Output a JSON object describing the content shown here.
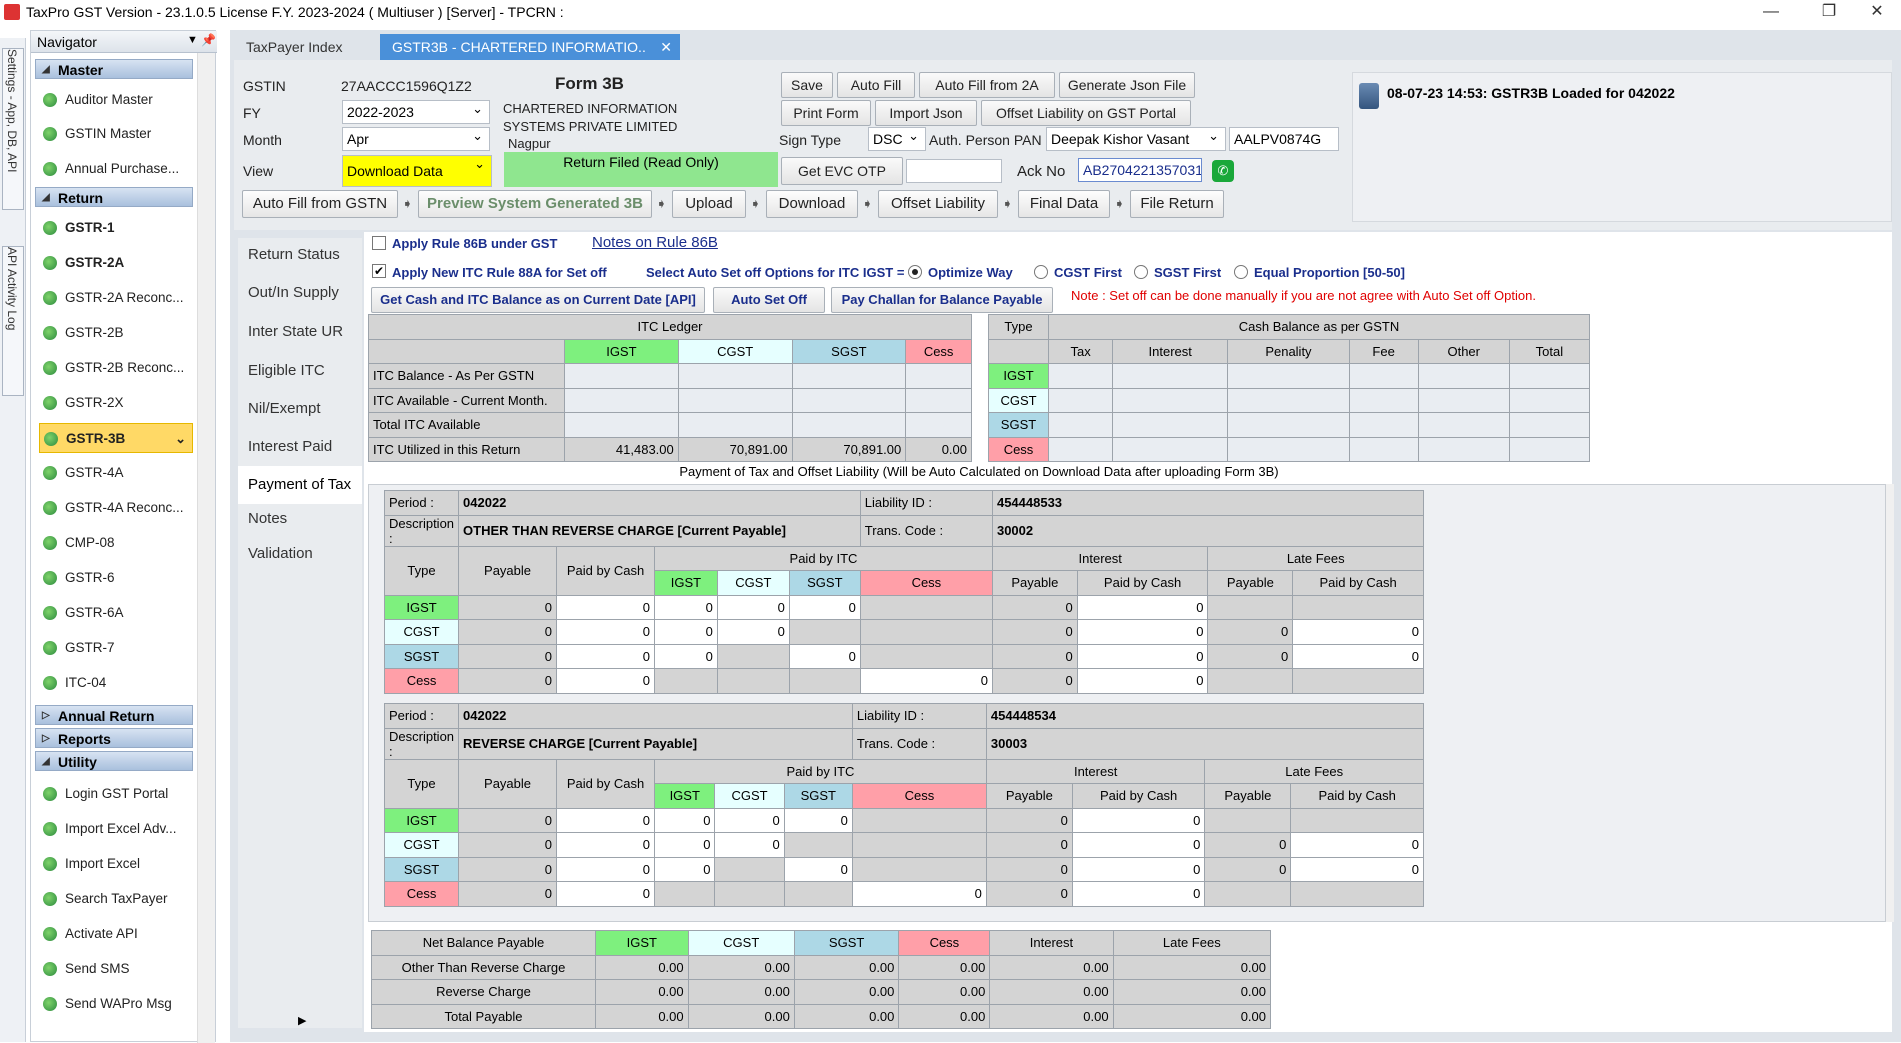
{
  "window": {
    "title": "TaxPro GST Version - 23.1.0.5 License F.Y. 2023-2024 ( Multiuser ) [Server]  - TPCRN :"
  },
  "lefttabs": [
    "Settings - App, DB, API",
    "API Activity Log"
  ],
  "navigator": {
    "title": "Navigator",
    "groups": {
      "master": "Master",
      "return": "Return",
      "annual": "Annual Return",
      "reports": "Reports",
      "utility": "Utility"
    },
    "master_items": [
      "Auditor Master",
      "GSTIN Master",
      "Annual Purchase..."
    ],
    "return_items": [
      "GSTR-1",
      "GSTR-2A",
      "GSTR-2A Reconc...",
      "GSTR-2B",
      "GSTR-2B Reconc...",
      "GSTR-2X",
      "GSTR-3B",
      "GSTR-4A",
      "GSTR-4A Reconc...",
      "CMP-08",
      "GSTR-6",
      "GSTR-6A",
      "GSTR-7",
      "ITC-04"
    ],
    "utility_items": [
      "Login GST Portal",
      "Import Excel Adv...",
      "Import Excel",
      "Search TaxPayer",
      "Activate API",
      "Send SMS",
      "Send WAPro Msg"
    ]
  },
  "tabs": {
    "t1": "TaxPayer Index",
    "t2": "GSTR3B - CHARTERED INFORMATIO..",
    "close": "✕"
  },
  "form": {
    "gstin_label": "GSTIN",
    "gstin": "27AACCC1596Q1Z2",
    "fy_label": "FY",
    "fy": "2022-2023",
    "month_label": "Month",
    "month": "Apr",
    "view_label": "View",
    "view": "Download Data",
    "form_title": "Form 3B",
    "company": "CHARTERED INFORMATION SYSTEMS PRIVATE LIMITED",
    "city": "Nagpur",
    "status": "Return Filed (Read Only)",
    "sign_type_label": "Sign Type",
    "sign_type": "DSC",
    "auth_label": "Auth. Person PAN",
    "auth_person": "Deepak Kishor Vasant",
    "pan": "AALPV0874G",
    "ack_label": "Ack No",
    "ack_no": "AB2704221357031"
  },
  "buttons": {
    "save": "Save",
    "autofill": "Auto Fill",
    "autofill2a": "Auto Fill from 2A",
    "genjson": "Generate Json File",
    "print": "Print Form",
    "importjson": "Import Json",
    "offsetportal": "Offset Liability on GST Portal",
    "evc": "Get EVC OTP"
  },
  "steps": [
    "Auto Fill from GSTN",
    "Preview System Generated 3B",
    "Upload",
    "Download",
    "Offset Liability",
    "Final Data",
    "File Return"
  ],
  "message": "08-07-23 14:53: GSTR3B Loaded for 042022",
  "sidemenu": [
    "Return Status",
    "Out/In Supply",
    "Inter State UR",
    "Eligible ITC",
    "Nil/Exempt",
    "Interest Paid",
    "Payment of Tax",
    "Notes",
    "Validation"
  ],
  "options": {
    "rule86b": "Apply Rule 86B under GST",
    "notes86b": "Notes on Rule 86B",
    "rule88a": "Apply New ITC Rule 88A for Set off",
    "setoff_label": "Select Auto Set off Options for ITC IGST =",
    "opt1": "Optimize Way",
    "opt2": "CGST First",
    "opt3": "SGST First",
    "opt4": "Equal Proportion [50-50]",
    "btn_cash": "Get Cash and ITC Balance as on Current Date [API]",
    "btn_auto": "Auto Set Off",
    "btn_challan": "Pay Challan for Balance Payable",
    "note": "Note : Set off can be done manually if you are not agree with Auto Set off Option."
  },
  "itc": {
    "title": "ITC Ledger",
    "cols": [
      "IGST",
      "CGST",
      "SGST",
      "Cess"
    ],
    "rows": [
      {
        "label": "ITC Balance - As Per GSTN",
        "vals": [
          "",
          "",
          "",
          ""
        ]
      },
      {
        "label": "ITC Available - Current Month.",
        "vals": [
          "",
          "",
          "",
          ""
        ]
      },
      {
        "label": "Total ITC Available",
        "vals": [
          "",
          "",
          "",
          ""
        ]
      },
      {
        "label": "ITC Utilized in this Return",
        "vals": [
          "41,483.00",
          "70,891.00",
          "70,891.00",
          "0.00"
        ]
      }
    ]
  },
  "cash": {
    "type": "Type",
    "title": "Cash Balance as per GSTN",
    "cols": [
      "Tax",
      "Interest",
      "Penality",
      "Fee",
      "Other",
      "Total"
    ],
    "rows": [
      "IGST",
      "CGST",
      "SGST",
      "Cess"
    ]
  },
  "payment_title": "Payment of Tax and Offset Liability (Will be Auto Calculated on Download Data after uploading Form 3B)",
  "pay_labels": {
    "period": "Period :",
    "desc": "Description :",
    "liab": "Liability ID :",
    "trans": "Trans. Code :",
    "type": "Type",
    "payable": "Payable",
    "paidcash": "Paid by Cash",
    "paiditc": "Paid by ITC",
    "interest": "Interest",
    "latefees": "Late Fees"
  },
  "blocks": [
    {
      "period": "042022",
      "desc": "OTHER THAN REVERSE CHARGE [Current Payable]",
      "liability": "454448533",
      "trans": "30002"
    },
    {
      "period": "042022",
      "desc": "REVERSE CHARGE [Current Payable]",
      "liability": "454448534",
      "trans": "30003"
    }
  ],
  "pay_types": [
    "IGST",
    "CGST",
    "SGST",
    "Cess"
  ],
  "zero": "0",
  "net": {
    "cols": [
      "Net Balance Payable",
      "IGST",
      "CGST",
      "SGST",
      "Cess",
      "Interest",
      "Late Fees"
    ],
    "rows": [
      {
        "label": "Other Than Reverse Charge",
        "vals": [
          "0.00",
          "0.00",
          "0.00",
          "0.00",
          "0.00",
          "0.00"
        ]
      },
      {
        "label": "Reverse Charge",
        "vals": [
          "0.00",
          "0.00",
          "0.00",
          "0.00",
          "0.00",
          "0.00"
        ]
      },
      {
        "label": "Total Payable",
        "vals": [
          "0.00",
          "0.00",
          "0.00",
          "0.00",
          "0.00",
          "0.00"
        ]
      }
    ]
  }
}
